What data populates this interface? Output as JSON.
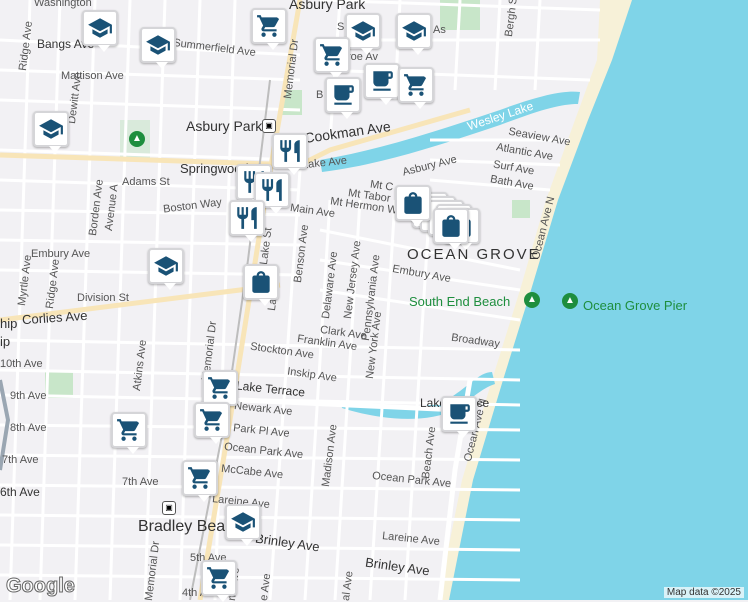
{
  "attribution": "Map data ©2025",
  "logo": "Google",
  "colors": {
    "water": "#7fd4e8",
    "land": "#f2f1f4",
    "road": "#ffffff",
    "major": "#f8e5b8",
    "park": "#c8e6c9",
    "beach": "#f7f1d8",
    "marker_icon": "#1a5276"
  },
  "labels": {
    "asbury_park": "Asbury Park",
    "asbury_park_top": "Asbury Park",
    "ocean_grove": "OCEAN GROVE",
    "bradley_beach": "Bradley Beach",
    "wesley_lake": "Wesley Lake",
    "south_end_beach": "South End Beach",
    "ocean_grove_pier": "Ocean Grove Pier",
    "washington": "Washington",
    "bangs_ave": "Bangs Ave",
    "summerfield_ave": "Summerfield Ave",
    "mattison_ave": "Mattison Ave",
    "ridge_ave": "Ridge Ave",
    "ridge_ave2": "Ridge Ave",
    "dewitt_ave": "Dewitt Ave",
    "cookman_ave": "Cookman Ave",
    "springwood": "Springwood",
    "lake_ave": "Lake Ave",
    "adams_st": "Adams St",
    "borden_ave": "Borden Ave",
    "avenue_a": "Avenue A",
    "boston_way": "Boston Way",
    "main_ave": "Main Ave",
    "embury_ave": "Embury Ave",
    "embury_ave2": "Embury Ave",
    "division_st": "Division St",
    "corlies_ave": "Corlies Ave",
    "myrtle_ave": "Myrtle Ave",
    "atkins_ave": "Atkins Ave",
    "memorial_dr": "Memorial Dr",
    "memorial_dr2": "Memorial Dr",
    "memorial_dr3": "Memorial Dr",
    "10th_ave": "10th Ave",
    "9th_ave": "9th Ave",
    "8th_ave": "8th Ave",
    "7th_ave": "7th Ave",
    "7th_ave2": "7th Ave",
    "6th_ave": "6th Ave",
    "5th_ave": "5th Ave",
    "4th_ave": "4th Ave",
    "stockton_ave": "Stockton Ave",
    "franklin_ave": "Franklin Ave",
    "inskip_ave": "Inskip Ave",
    "lake_terrace": "Lake Terrace",
    "lake_terrace2": "Lake Terrace",
    "newark_ave": "Newark Ave",
    "park_pl_ave": "Park Pl Ave",
    "ocean_park_ave": "Ocean Park Ave",
    "ocean_park_ave2": "Ocean Park Ave",
    "mccabe_ave": "McCabe Ave",
    "lareine_ave": "Lareine Ave",
    "lareine_ave2": "Lareine Ave",
    "brinley_ave": "Brinley Ave",
    "brinley_ave2": "Brinley Ave",
    "madison_ave": "Madison Ave",
    "beach_ave": "Beach Ave",
    "ocean_ave_n": "Ocean Ave N",
    "ocean_ave_n2": "Ocean Ave N",
    "benson_ave": "Benson Ave",
    "delaware_ave": "Delaware Ave",
    "new_jersey_ave": "New Jersey Ave",
    "pennsylvania_ave": "Pennsylvania Ave",
    "new_york_ave": "New York Ave",
    "clark_ave": "Clark Ave",
    "broadway": "Broadway",
    "asbury_ave": "Asbury Ave",
    "mt_carmel": "Mt C",
    "mt_tabor": "Mt Tabor",
    "mt_hermon": "Mt Hermon W",
    "seaview_ave": "Seaview Ave",
    "atlantic_ave": "Atlantic Ave",
    "surf_ave": "Surf Ave",
    "bath_ave": "Bath Ave",
    "bergh_st": "Bergh St",
    "lake_st": "Lake St",
    "lake_ave3": "La",
    "hip": "hip",
    "ip": "ip",
    "s_as": "S",
    "as": "As",
    "roe_av": "roe Av",
    "b_e": "B",
    "lake_st2": "St",
    "ave_al": "al Ave",
    "e_ave": "e Ave",
    "nd_ave": "nd Ave",
    "ake": "ake Ave"
  },
  "markers": [
    {
      "type": "school",
      "name": "school-marker"
    },
    {
      "type": "school",
      "name": "school-marker"
    },
    {
      "type": "shopping",
      "name": "shopping-cart-marker"
    },
    {
      "type": "school",
      "name": "school-marker"
    },
    {
      "type": "school",
      "name": "school-marker"
    },
    {
      "type": "shopping",
      "name": "shopping-cart-marker"
    },
    {
      "type": "cafe",
      "name": "cafe-marker"
    },
    {
      "type": "shopping",
      "name": "shopping-cart-marker"
    },
    {
      "type": "cafe",
      "name": "cafe-marker"
    },
    {
      "type": "school",
      "name": "school-marker"
    },
    {
      "type": "restaurant",
      "name": "restaurant-marker"
    },
    {
      "type": "restaurant",
      "name": "restaurant-marker"
    },
    {
      "type": "restaurant",
      "name": "restaurant-marker"
    },
    {
      "type": "restaurant",
      "name": "restaurant-marker"
    },
    {
      "type": "school",
      "name": "school-marker"
    },
    {
      "type": "store",
      "name": "store-marker"
    },
    {
      "type": "store",
      "name": "store-marker"
    },
    {
      "type": "store",
      "name": "store-marker"
    },
    {
      "type": "shopping",
      "name": "shopping-cart-marker"
    },
    {
      "type": "shopping",
      "name": "shopping-cart-marker"
    },
    {
      "type": "shopping",
      "name": "shopping-cart-marker"
    },
    {
      "type": "shopping",
      "name": "shopping-cart-marker"
    },
    {
      "type": "shopping",
      "name": "shopping-cart-marker"
    },
    {
      "type": "school",
      "name": "school-marker"
    },
    {
      "type": "cafe",
      "name": "cafe-marker"
    }
  ]
}
